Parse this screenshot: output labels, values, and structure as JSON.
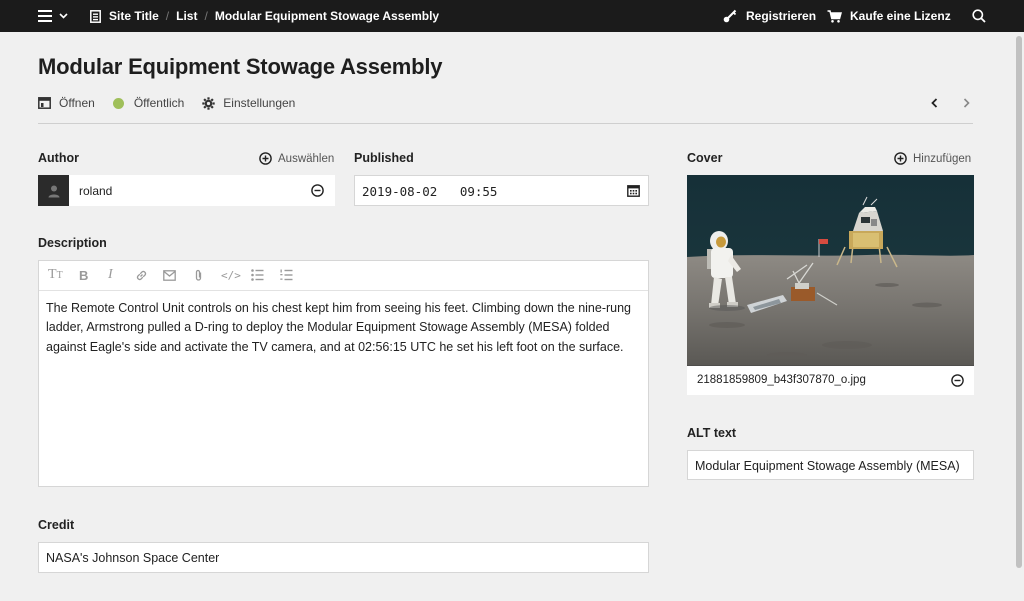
{
  "topbar": {
    "breadcrumb": [
      "Site Title",
      "List",
      "Modular Equipment Stowage Assembly"
    ],
    "register_label": "Registrieren",
    "license_label": "Kaufe eine Lizenz"
  },
  "page": {
    "title": "Modular Equipment Stowage Assembly",
    "actions": {
      "open_label": "Öffnen",
      "status_label": "Öffentlich",
      "settings_label": "Einstellungen"
    },
    "status_color": "#9fbf5a"
  },
  "author": {
    "label": "Author",
    "select_label": "Auswählen",
    "name": "roland"
  },
  "published": {
    "label": "Published",
    "value": "2019-08-02   09:55"
  },
  "description": {
    "label": "Description",
    "text": "The Remote Control Unit controls on his chest kept him from seeing his feet. Climbing down the nine-rung ladder, Armstrong pulled a D-ring to deploy the Modular Equipment Stowage Assembly (MESA) folded against Eagle's side and activate the TV camera, and at 02:56:15 UTC he set his left foot on the surface."
  },
  "credit": {
    "label": "Credit",
    "value": "NASA's Johnson Space Center"
  },
  "cover": {
    "label": "Cover",
    "add_label": "Hinzufügen",
    "filename": "21881859809_b43f307870_o.jpg"
  },
  "alt": {
    "label": "ALT text",
    "value": "Modular Equipment Stowage Assembly (MESA) "
  },
  "icons": {
    "menu": "hamburger-icon",
    "page": "page-icon",
    "register": "key-icon",
    "cart": "cart-icon",
    "search": "search-icon",
    "open": "open-icon",
    "settings": "gear-icon"
  }
}
